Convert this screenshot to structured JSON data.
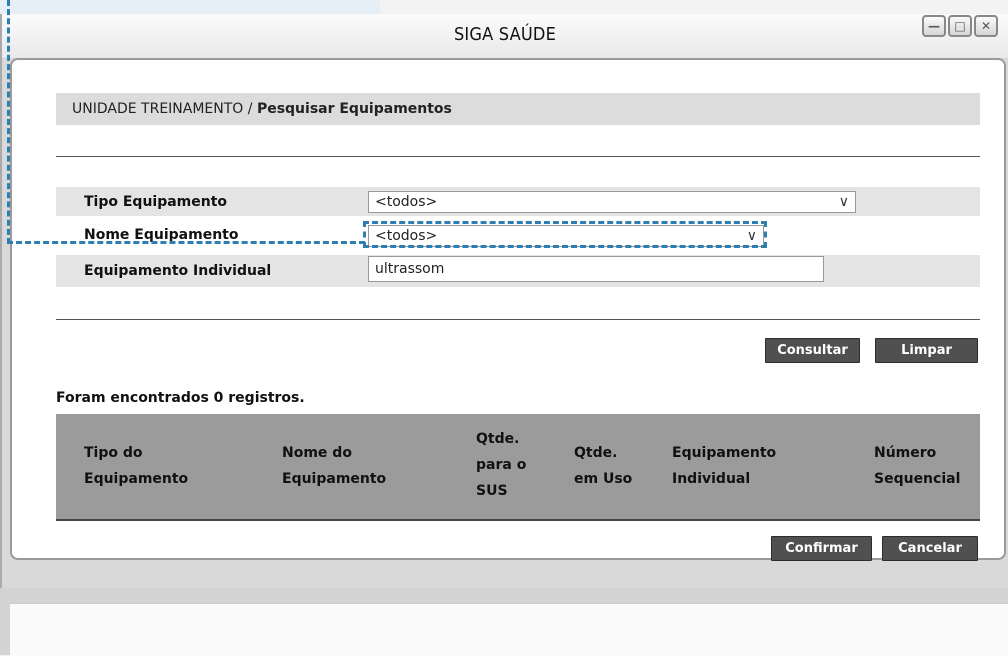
{
  "window": {
    "title": "SIGA SAÚDE",
    "controls": [
      "minimize-icon",
      "maximize-icon",
      "close-icon"
    ]
  },
  "breadcrumb": {
    "unit": "UNIDADE TREINAMENTO /",
    "page": "Pesquisar Equipamentos"
  },
  "form": {
    "tipo_label": "Tipo Equipamento",
    "tipo_value": "<todos>",
    "nome_label": "Nome Equipamento",
    "nome_value": "<todos>",
    "individual_label": "Equipamento Individual",
    "individual_value": "ultrassom"
  },
  "actions": {
    "consultar": "Consultar",
    "limpar": "Limpar",
    "confirmar": "Confirmar",
    "cancelar": "Cancelar"
  },
  "results": {
    "message": "Foram encontrados 0 registros.",
    "columns": [
      [
        "Tipo do",
        "Equipamento"
      ],
      [
        "Nome do",
        "Equipamento"
      ],
      [
        "Qtde.",
        "para o",
        "SUS"
      ],
      [
        "Qtde.",
        "em Uso"
      ],
      [
        "Equipamento",
        "Individual"
      ],
      [
        "Número",
        "Sequencial"
      ]
    ]
  },
  "colors": {
    "highlight": "#2c7fb3",
    "button": "#505050"
  }
}
